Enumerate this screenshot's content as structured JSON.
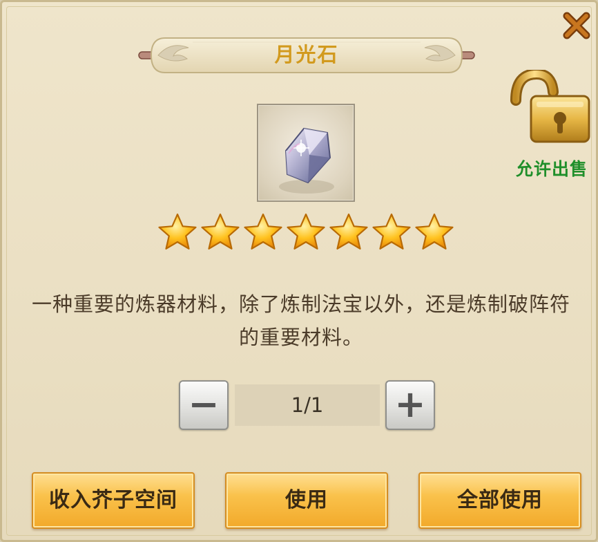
{
  "dialog": {
    "title": "月光石",
    "item_icon": "moonstone-crystal-icon",
    "star_count": 7,
    "stars_max": 7,
    "description": "一种重要的炼器材料，除了炼制法宝以外，还是炼制破阵符的重要材料。",
    "sell_label": "允许出售",
    "sell_icon": "unlocked-padlock-icon",
    "close_icon": "close-x-icon"
  },
  "quantity": {
    "display": "1/1",
    "minus_label": "−",
    "plus_label": "+"
  },
  "actions": {
    "store_label": "收入芥子空间",
    "use_label": "使用",
    "use_all_label": "全部使用"
  },
  "colors": {
    "title": "#d29a1e",
    "sell_label": "#1f8f2a",
    "close": "#b5651d",
    "button_gold": "#f9c049",
    "description": "#4b3b29"
  }
}
